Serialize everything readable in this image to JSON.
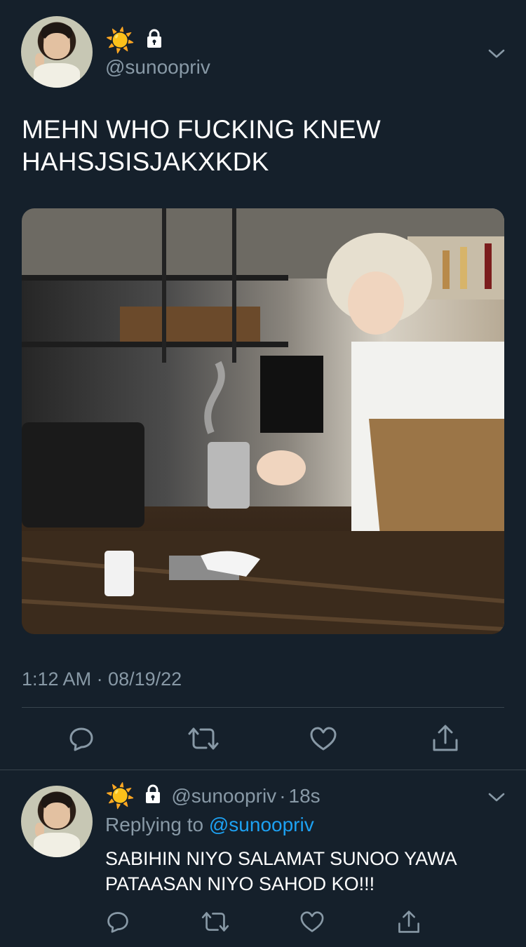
{
  "tweet": {
    "emoji": "☀️",
    "handle": "@sunoopriv",
    "text_line1": "MEHN WHO FUCKING KNEW",
    "text_line2": "HAHSJSISJAKXKDK",
    "timestamp": "1:12 AM · 08/19/22"
  },
  "reply": {
    "emoji": "☀️",
    "handle": "@sunoopriv",
    "sep": "·",
    "age": "18s",
    "replying_prefix": "Replying to ",
    "replying_to": "@sunoopriv",
    "text_line1": "SABIHIN NIYO SALAMAT SUNOO YAWA",
    "text_line2": "PATAASAN NIYO SAHOD KO!!!"
  },
  "icons": [
    "reply-icon",
    "retweet-icon",
    "like-icon",
    "share-icon",
    "lock-icon",
    "chevron-down-icon"
  ],
  "colors": {
    "background": "#15202b",
    "secondary_text": "#8899a6",
    "link": "#1da1f2",
    "divider": "#38444d"
  }
}
